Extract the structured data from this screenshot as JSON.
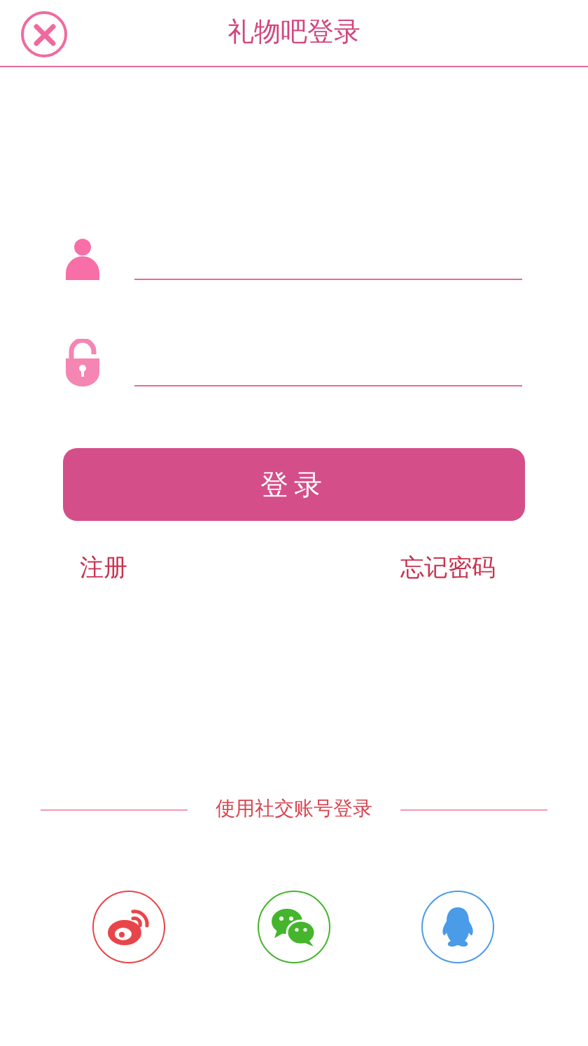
{
  "header": {
    "title": "礼物吧登录"
  },
  "fields": [
    {
      "kind": "user"
    },
    {
      "kind": "lock"
    }
  ],
  "login_button": "登录",
  "links": [
    "注册",
    "忘记密码"
  ],
  "social": {
    "label": "使用社交账号登录",
    "items": [
      {
        "kind": "weibo",
        "color": "#e8454a"
      },
      {
        "kind": "wechat",
        "color": "#44b52c"
      },
      {
        "kind": "qq",
        "color": "#4a9be8"
      }
    ]
  }
}
